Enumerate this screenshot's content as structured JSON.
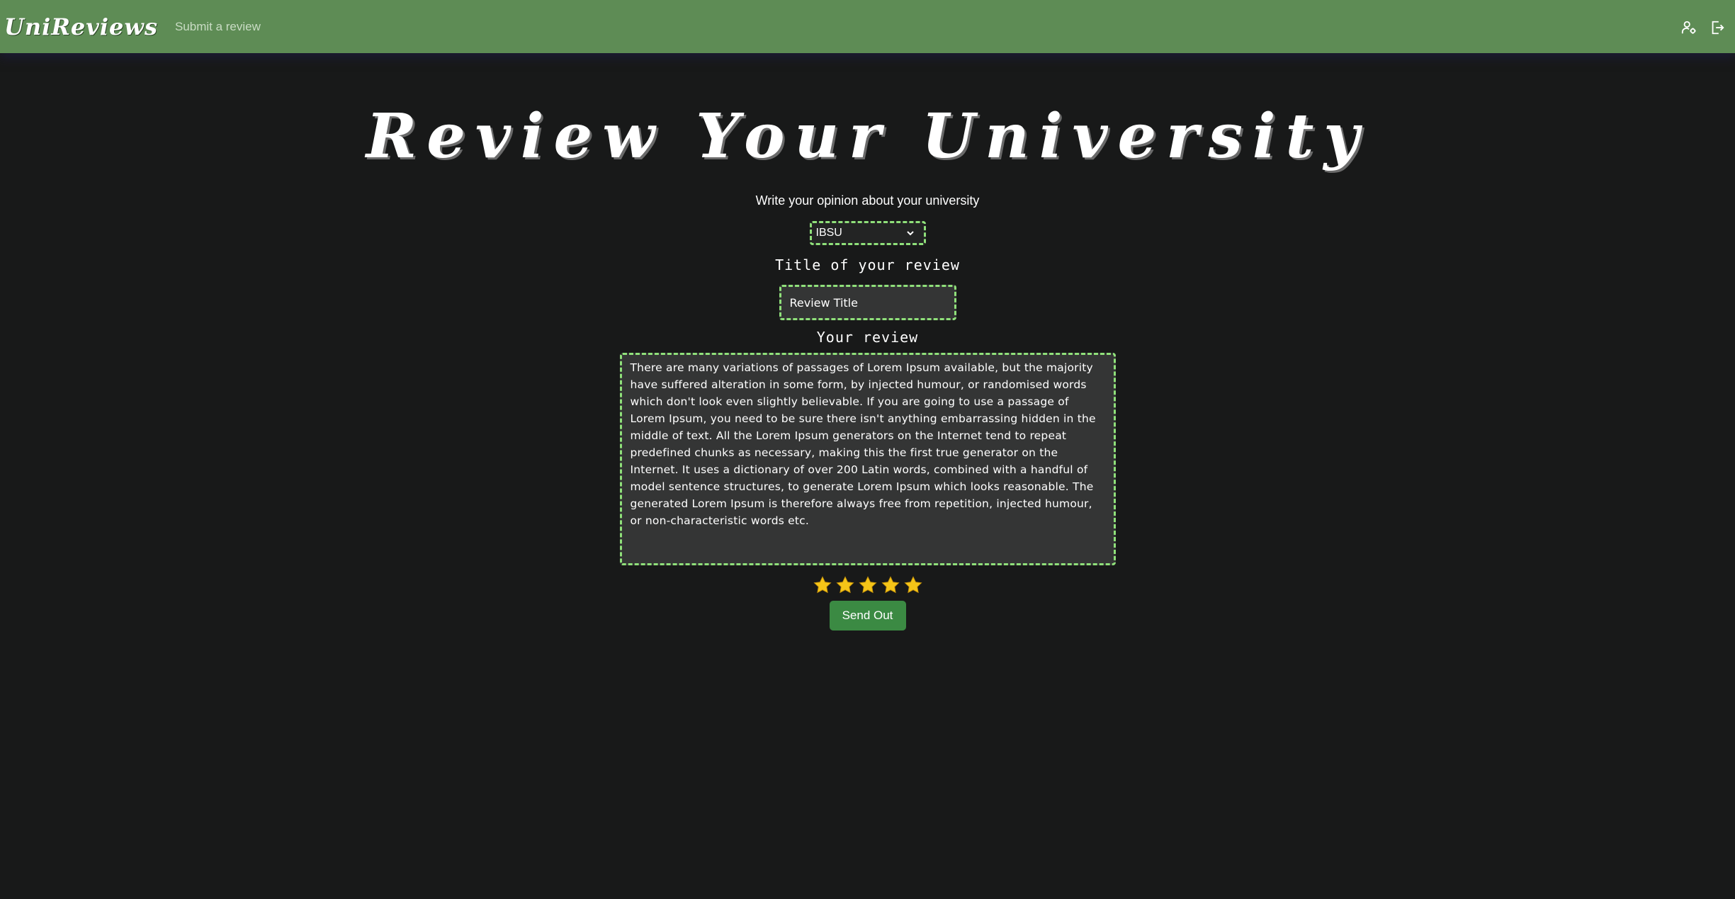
{
  "navbar": {
    "brand": "UniReviews",
    "submit_link": "Submit a review",
    "icons": [
      "user-settings-icon",
      "logout-icon"
    ]
  },
  "main": {
    "heading": "Review Your University",
    "subtitle": "Write your opinion about your university",
    "university_select": {
      "selected": "IBSU"
    },
    "title_label": "Title of your review",
    "title_input": {
      "placeholder": "Review Title"
    },
    "review_label": "Your review",
    "review_text": "There are many variations of passages of Lorem Ipsum available, but the majority have suffered alteration in some form, by injected humour, or randomised words which don't look even slightly believable. If you are going to use a passage of Lorem Ipsum, you need to be sure there isn't anything embarrassing hidden in the middle of text. All the Lorem Ipsum generators on the Internet tend to repeat predefined chunks as necessary, making this the first true generator on the Internet. It uses a dictionary of over 200 Latin words, combined with a handful of model sentence structures, to generate Lorem Ipsum which looks reasonable. The generated Lorem Ipsum is therefore always free from repetition, injected humour, or non-characteristic words etc.",
    "rating": 5,
    "rating_max": 5,
    "send_button": "Send Out"
  },
  "colors": {
    "navbar": "#5e8c55",
    "background": "#181919",
    "field_border": "#8fe07a",
    "star": "#f5c518",
    "button": "#3b8a43"
  }
}
